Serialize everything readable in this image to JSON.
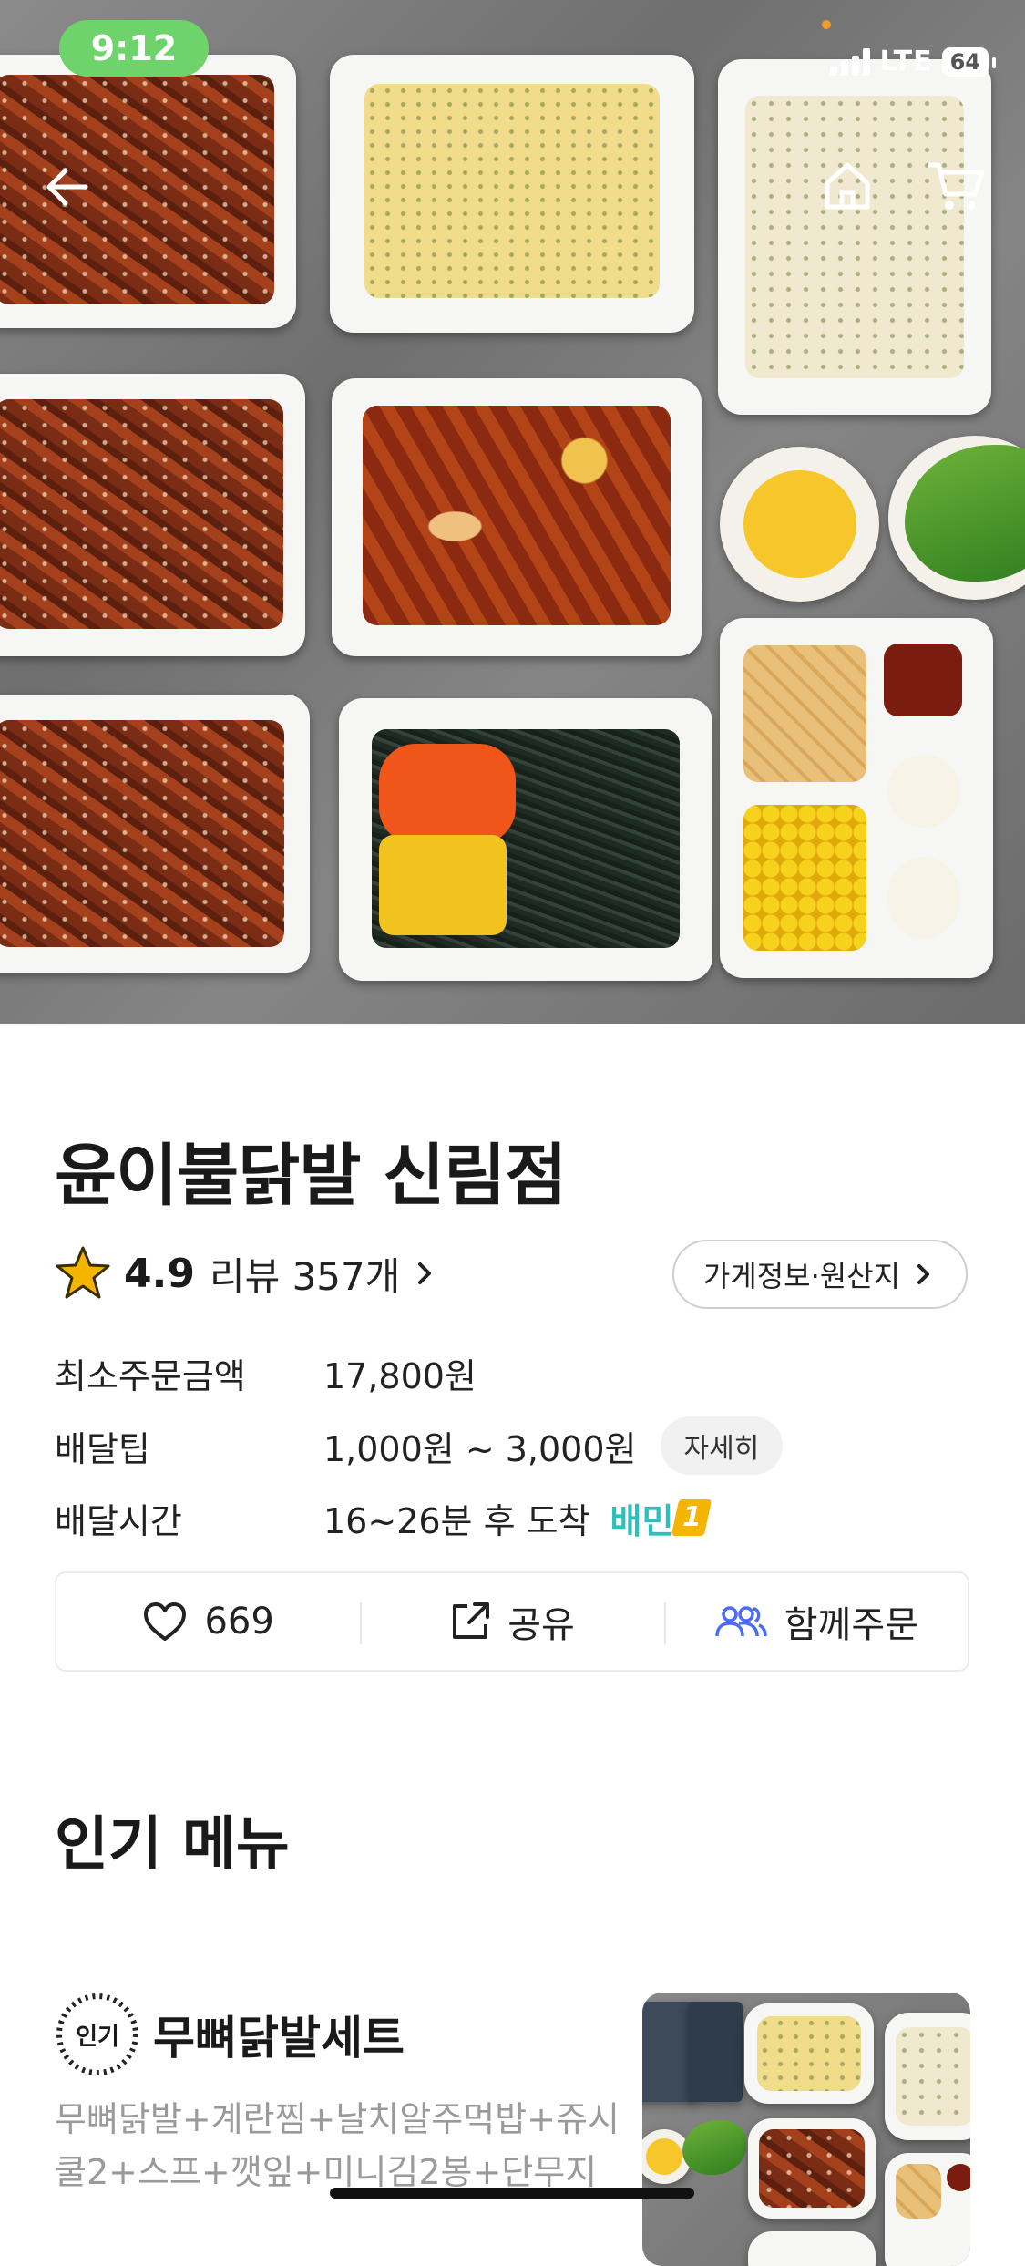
{
  "status_bar": {
    "time": "9:12",
    "network": "LTE",
    "battery": "64"
  },
  "top_nav": {
    "back_icon": "back-arrow-icon",
    "home_icon": "home-icon",
    "cart_icon": "cart-icon"
  },
  "store": {
    "name": "윤이불닭발 신림점",
    "rating": "4.9",
    "reviews_label": "리뷰 357개",
    "store_info_button": "가게정보·원산지"
  },
  "details": [
    {
      "label": "최소주문금액",
      "value": "17,800원"
    },
    {
      "label": "배달팁",
      "value": "1,000원 ~ 3,000원",
      "chip": "자세히"
    },
    {
      "label": "배달시간",
      "value": "16~26분 후 도착",
      "badge_text": "배민",
      "badge_number": "1"
    }
  ],
  "actions": {
    "like_count": "669",
    "share_label": "공유",
    "group_order_label": "함께주문"
  },
  "popular": {
    "section_title": "인기 메뉴",
    "items": [
      {
        "badge": "인기",
        "name": "무뼈닭발세트",
        "description": "무뼈닭발+계란찜+날치알주먹밥+쥬시쿨2+스프+깻잎+미니김2봉+단무지"
      }
    ]
  },
  "colors": {
    "accent": "#2ac1bc",
    "group_icon": "#4a6cf7",
    "status_pill": "#6ed36b",
    "star": "#f4b400"
  }
}
